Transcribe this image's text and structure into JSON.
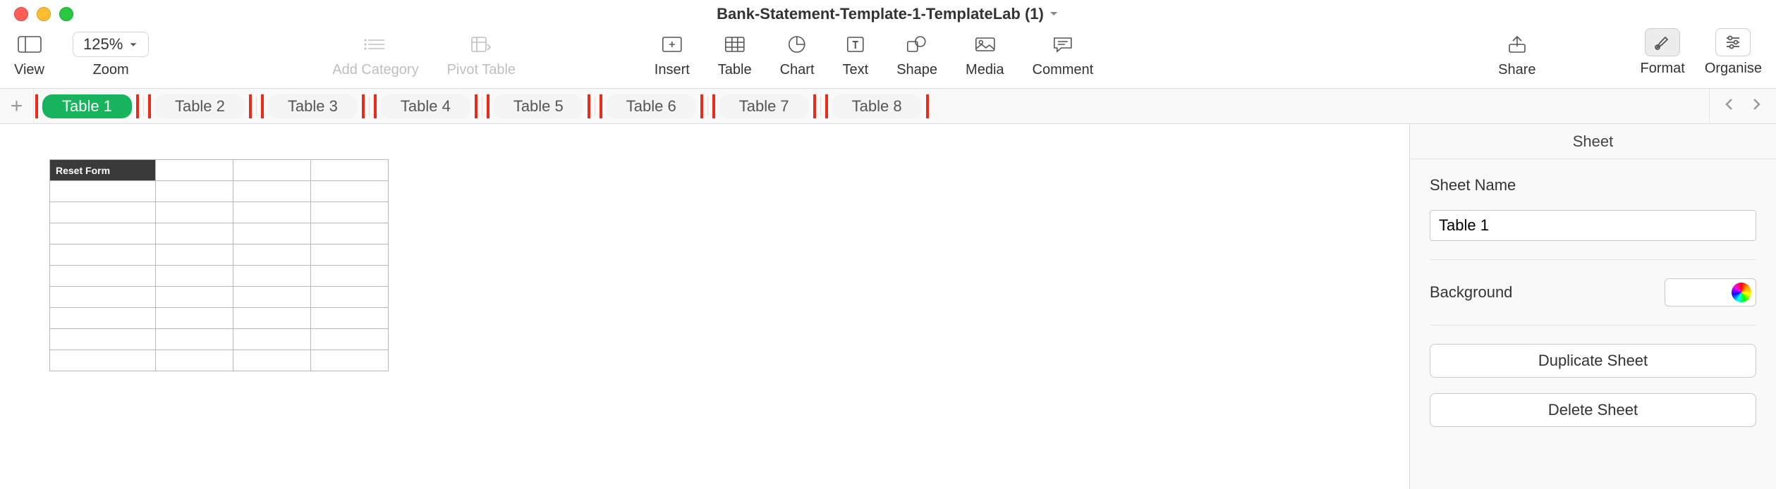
{
  "window": {
    "title": "Bank-Statement-Template-1-TemplateLab (1)"
  },
  "toolbar": {
    "view": "View",
    "zoom_label": "Zoom",
    "zoom_value": "125%",
    "add_category": "Add Category",
    "pivot_table": "Pivot Table",
    "insert": "Insert",
    "table": "Table",
    "chart": "Chart",
    "text": "Text",
    "shape": "Shape",
    "media": "Media",
    "comment": "Comment",
    "share": "Share",
    "format": "Format",
    "organise": "Organise"
  },
  "tabs": [
    {
      "label": "Table 1",
      "active": true,
      "highlighted": true
    },
    {
      "label": "Table 2",
      "active": false,
      "highlighted": true
    },
    {
      "label": "Table 3",
      "active": false,
      "highlighted": true
    },
    {
      "label": "Table 4",
      "active": false,
      "highlighted": true
    },
    {
      "label": "Table 5",
      "active": false,
      "highlighted": true
    },
    {
      "label": "Table 6",
      "active": false,
      "highlighted": true
    },
    {
      "label": "Table 7",
      "active": false,
      "highlighted": true
    },
    {
      "label": "Table 8",
      "active": false,
      "highlighted": true
    }
  ],
  "spreadsheet": {
    "header_cell": "Reset Form",
    "cols": 4,
    "rows": 10
  },
  "inspector": {
    "panel_title": "Sheet",
    "sheet_name_label": "Sheet Name",
    "sheet_name_value": "Table 1",
    "background_label": "Background",
    "duplicate_btn": "Duplicate Sheet",
    "delete_btn": "Delete Sheet"
  }
}
